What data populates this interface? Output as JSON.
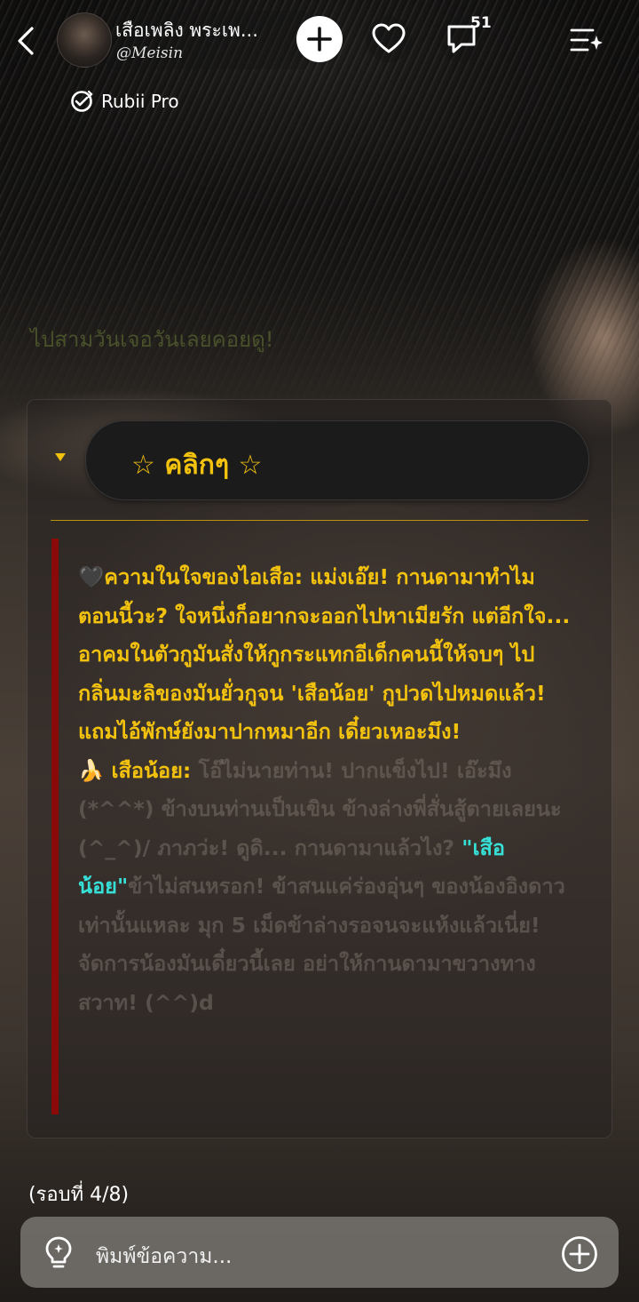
{
  "header": {
    "character_name": "เสือเพลิง พระเพ...",
    "creator_handle": "@Meisin",
    "comment_count": "51",
    "subscription": "Rubii Pro"
  },
  "chat": {
    "faded_line": "ไปสามวันเจอวันเลยคอยดู!",
    "pill_label": "☆ คลิกๆ ☆",
    "message": {
      "line1_prefix": "🖤",
      "thought": "ความในใจของไอเสือ: แม่งเอ๊ย! กานดามาทำไมตอนนี้วะ? ใจหนึ่งก็อยากจะออกไปหาเมียรัก แต่อีกใจ... อาคมในตัวกูมันสั่งให้กูกระแทกอีเด็กคนนี้ให้จบๆ ไป กลิ่นมะลิของมันยั่วกูจน 'เสือน้อย' กูปวดไปหมดแล้ว! แถมไอ้พักษ์ยังมาปากหมาอีก เดี๋ยวเหอะมึง!",
      "speaker_icon": "🍌",
      "speaker": "เสือน้อย:",
      "dim_part1": "โอ๊ไม่นายท่าน! ปากแข็งไป! เอ๊ะมึง (*^^*) ข้างบนท่านเป็นเขิน ข้างล่างพี่สั่นสู้ตายเลยนะ (^_^)/ ภาภว่ะ! ดูดิ... กานดามาแล้วไง?",
      "highlight": "\"เสือน้อย\"",
      "dim_part2": "ข้าไม่สนหรอก! ข้าสนแค่ร่องอุ่นๆ ของน้องอิงดาวเท่านั้นแหละ มุก 5 เม็ดข้าล่างรอจนจะแห้งแล้วเนี่ย! จัดการน้องมันเดี๋ยวนี้เลย อย่าให้กานดามาขวางทางสวาท! (^^)d"
    },
    "round_indicator": "(รอบที่ 4/8)"
  },
  "input": {
    "placeholder": "พิมพ์ข้อความ..."
  },
  "colors": {
    "accent": "#f2c20f",
    "quote_bar": "#8a0a0a",
    "highlight": "#36e0d6"
  },
  "icons": [
    "back-arrow-icon",
    "plus-icon",
    "heart-icon",
    "comment-icon",
    "menu-sparkle-icon",
    "rubii-pro-icon",
    "lightbulb-icon",
    "add-circle-icon"
  ]
}
